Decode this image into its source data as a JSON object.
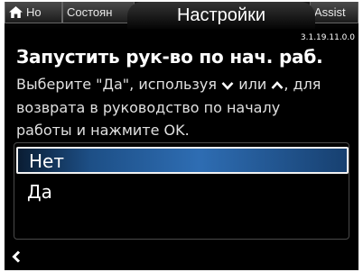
{
  "header": {
    "tabs": {
      "home": "Ho",
      "status": "Состоян",
      "title": "Настройки",
      "assist": "Assist"
    },
    "version": "3.1.19.11.0.0"
  },
  "icons": {
    "home": "home-icon",
    "down": "chevron-down-icon",
    "up": "chevron-up-icon",
    "back": "back-arrow-icon"
  },
  "main": {
    "heading": "Запустить рук-во по нач. раб.",
    "description": {
      "part1": "Выберите \"Да\", используя",
      "part2": "или",
      "part3": ", для",
      "line2": "возврата в руководство по началу",
      "line3": "работы и нажмите OK."
    },
    "options": [
      {
        "label": "Нет",
        "selected": true
      },
      {
        "label": "Да",
        "selected": false
      }
    ]
  },
  "colors": {
    "selection": "#2e6db3",
    "background": "#000000"
  }
}
